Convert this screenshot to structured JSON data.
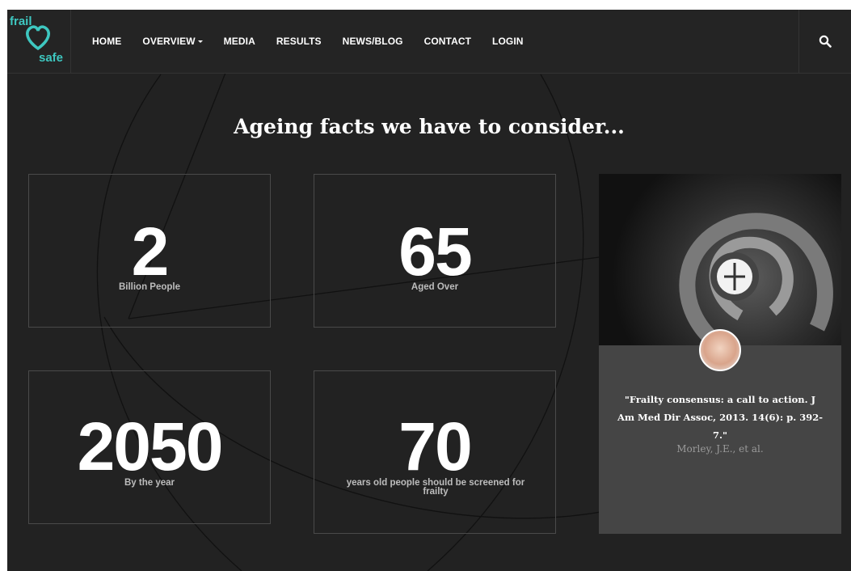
{
  "logo": {
    "line1": "frail",
    "line2": "safe",
    "color": "#3ec7c0"
  },
  "nav": {
    "items": [
      {
        "label": "HOME"
      },
      {
        "label": "OVERVIEW"
      },
      {
        "label": "MEDIA"
      },
      {
        "label": "RESULTS"
      },
      {
        "label": "NEWS/BLOG"
      },
      {
        "label": "CONTACT"
      },
      {
        "label": "LOGIN"
      }
    ],
    "search_icon": "search-icon"
  },
  "section": {
    "title": "Ageing facts we have to consider..."
  },
  "stats": [
    {
      "value": "2",
      "label": "Billion People"
    },
    {
      "value": "65",
      "label": "Aged Over"
    },
    {
      "value": "2050",
      "label": "By the year"
    },
    {
      "value": "70",
      "label": "years old people should be screened for frailty"
    }
  ],
  "testimonial": {
    "quote": "\"Frailty consensus: a call to action. J Am Med Dir Assoc, 2013. 14(6): p. 392-7.\"",
    "author": "Morley, J.E., et al."
  },
  "colors": {
    "background": "#222222",
    "card": "#454545",
    "accent": "#3ec7c0"
  }
}
